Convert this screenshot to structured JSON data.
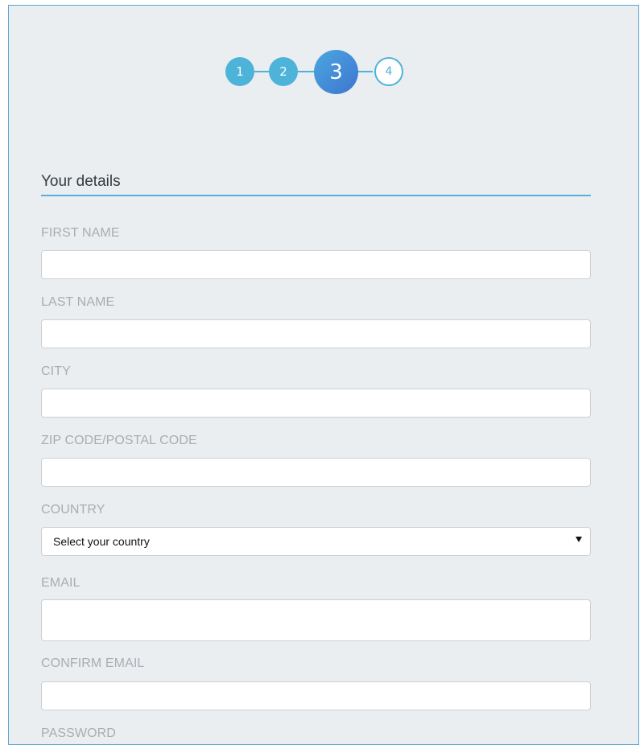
{
  "stepper": {
    "steps": [
      {
        "label": "1",
        "state": "done"
      },
      {
        "label": "2",
        "state": "done"
      },
      {
        "label": "3",
        "state": "current"
      },
      {
        "label": "4",
        "state": "todo"
      }
    ],
    "colors": {
      "accent": "#4db3d9",
      "current_start": "#4aa8e0",
      "current_end": "#3f74d0"
    }
  },
  "section": {
    "title": "Your details"
  },
  "form": {
    "first_name_label": "FIRST NAME",
    "first_name_value": "",
    "last_name_label": "LAST NAME",
    "last_name_value": "",
    "city_label": "CITY",
    "city_value": "",
    "zip_label": "ZIP CODE/POSTAL CODE",
    "zip_value": "",
    "country_label": "COUNTRY",
    "country_selected": "Select your country",
    "email_label": "EMAIL",
    "email_value": "",
    "confirm_email_label": "CONFIRM EMAIL",
    "confirm_email_value": "",
    "password_label": "PASSWORD"
  },
  "colors": {
    "background": "#ebeef0",
    "frame_border": "#5aa6d2",
    "label": "#a9adb1",
    "section_rule": "#5aaedb"
  }
}
